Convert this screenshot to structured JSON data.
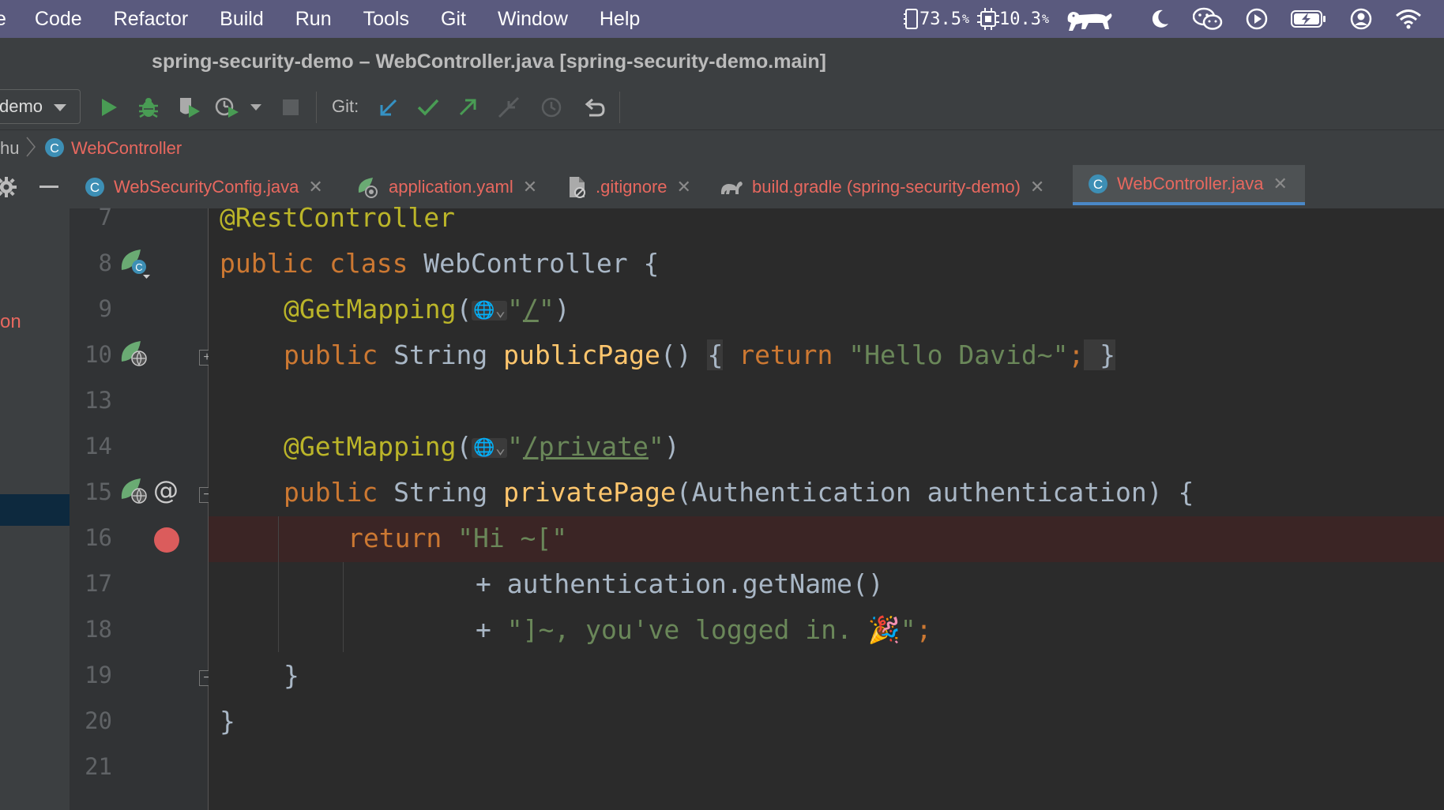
{
  "menubar": {
    "items": [
      "e",
      "Code",
      "Refactor",
      "Build",
      "Run",
      "Tools",
      "Git",
      "Window",
      "Help"
    ],
    "memory_value": "73.5",
    "cpu_value": "10.3",
    "unit": "%"
  },
  "window": {
    "title": "spring-security-demo – WebController.java [spring-security-demo.main]"
  },
  "toolbar": {
    "run_config": "demo",
    "git_label": "Git:"
  },
  "breadcrumb": {
    "prev": "hu",
    "current": "WebController"
  },
  "tabs": [
    {
      "label": "WebSecurityConfig.java",
      "icon": "java-class-icon",
      "active": false
    },
    {
      "label": "application.yaml",
      "icon": "spring-yaml-icon",
      "active": false
    },
    {
      "label": ".gitignore",
      "icon": "gitignore-file-icon",
      "active": false
    },
    {
      "label": "build.gradle (spring-security-demo)",
      "icon": "gradle-icon",
      "active": false
    },
    {
      "label": "WebController.java",
      "icon": "java-class-icon",
      "active": true
    }
  ],
  "project_panel": {
    "visible_fragment": "on"
  },
  "editor": {
    "line_numbers": [
      "7",
      "8",
      "9",
      "10",
      "13",
      "14",
      "15",
      "16",
      "17",
      "18",
      "19",
      "20",
      "21"
    ],
    "code": {
      "l7_annotation": "@RestController",
      "l8_kw1": "public",
      "l8_kw2": "class",
      "l8_rest": " WebController {",
      "l9_annotation": "@GetMapping",
      "l9_paren_open": "(",
      "l9_str_open": "\"",
      "l9_path": "/",
      "l9_str_close": "\"",
      "l9_paren_close": ")",
      "l10_kw": "public",
      "l10_type": " String ",
      "l10_fn": "publicPage",
      "l10_parens": "() ",
      "l10_brace_open": "{",
      "l10_return": " return",
      "l10_str": " \"Hello David~\"",
      "l10_semi": ";",
      "l10_brace_close": " }",
      "l14_annotation": "@GetMapping",
      "l14_paren_open": "(",
      "l14_str_open": "\"",
      "l14_path": "/private",
      "l14_str_close": "\"",
      "l14_paren_close": ")",
      "l15_kw": "public",
      "l15_type": " String ",
      "l15_fn": "privatePage",
      "l15_rest": "(Authentication authentication) {",
      "l16_return": "return",
      "l16_str": " \"Hi ~[\"",
      "l17_text": "+ authentication.getName()",
      "l18_plus": "+ ",
      "l18_str": "\"]~, you've logged in. 🎉\"",
      "l18_semi": ";",
      "l19_text": "}",
      "l20_text": "}"
    },
    "gutter_markers": {
      "autowire": "@"
    }
  }
}
